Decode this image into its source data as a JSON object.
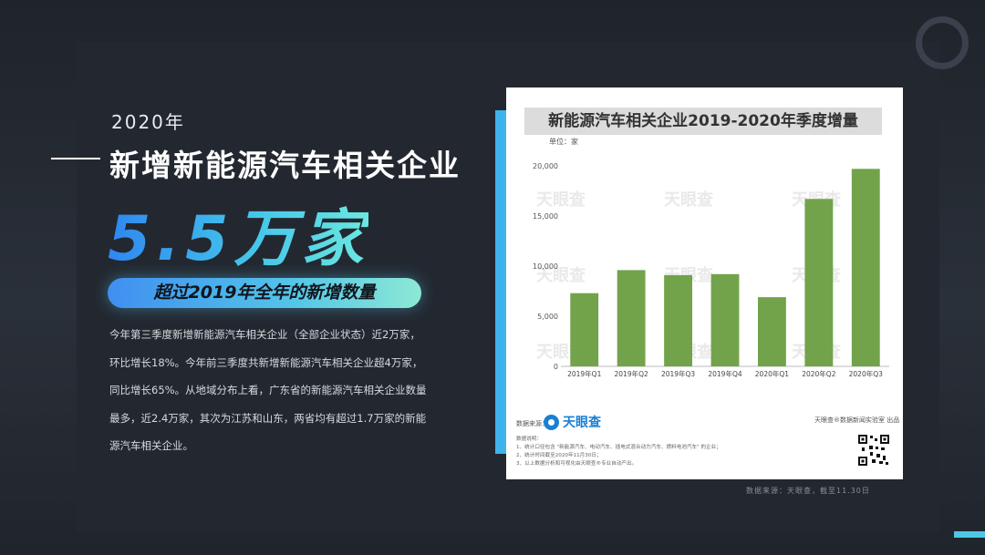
{
  "left": {
    "year": "2020年",
    "headline": "新增新能源汽车相关企业",
    "big_number": "5.5万家",
    "pill": "超过2019年全年的新增数量",
    "paragraph_lines": [
      "今年第三季度新增新能源汽车相关企业（全部企业状态）近2万家，",
      "环比增长18%。今年前三季度共新增新能源汽车相关企业超4万家，",
      "同比增长65%。从地域分布上看，广东省的新能源汽车相关企业数量",
      "最多，近2.4万家，其次为江苏和山东，两省均有超过1.7万家的新能",
      "源汽车相关企业。"
    ]
  },
  "card": {
    "unit": "单位：家",
    "watermark": "天眼查",
    "source_label": "数据来源：",
    "logo_text": "天眼查",
    "notes_title": "数据说明：",
    "notes": [
      "1、统计口径包含 \"新能源汽车、电动汽车、插电式混合动力汽车、燃料电池汽车\" 的企业；",
      "2、统计时间截至2020年11月30日；",
      "3、以上数据分析和可视化由天眼查®专业自动产出。"
    ],
    "publisher": "天眼查®数据新闻实验室 出品"
  },
  "credit": "数据来源：天眼查，截至11.30日",
  "colors": {
    "bar": "#72a34a",
    "accent": "#3fb3ec",
    "background": "#262b33"
  },
  "chart_data": {
    "type": "bar",
    "title": "新能源汽车相关企业2019-2020年季度增量",
    "categories": [
      "2019年Q1",
      "2019年Q2",
      "2019年Q3",
      "2019年Q4",
      "2020年Q1",
      "2020年Q2",
      "2020年Q3"
    ],
    "values": [
      7300,
      9600,
      9100,
      9200,
      6900,
      16700,
      19700
    ],
    "ylim": [
      0,
      20000
    ],
    "yticks": [
      0,
      5000,
      10000,
      15000,
      20000
    ],
    "ytick_labels": [
      "0",
      "5,000",
      "10,000",
      "15,000",
      "20,000"
    ],
    "grid": false,
    "legend": "none"
  }
}
